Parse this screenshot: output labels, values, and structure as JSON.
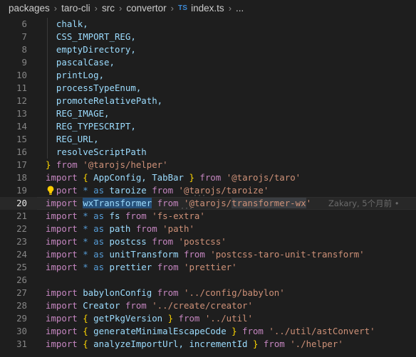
{
  "breadcrumb": {
    "items": [
      "packages",
      "taro-cli",
      "src",
      "convertor"
    ],
    "file_badge": "TS",
    "file_name": "index.ts",
    "trailing": "..."
  },
  "editor": {
    "current_line": 20,
    "blame": "Zakary, 5个月前 •",
    "lines": [
      {
        "n": "6",
        "tokens": [
          {
            "t": "  chalk,",
            "c": "id"
          }
        ]
      },
      {
        "n": "7",
        "tokens": [
          {
            "t": "  CSS_IMPORT_REG,",
            "c": "id"
          }
        ]
      },
      {
        "n": "8",
        "tokens": [
          {
            "t": "  emptyDirectory,",
            "c": "id"
          }
        ]
      },
      {
        "n": "9",
        "tokens": [
          {
            "t": "  pascalCase,",
            "c": "id"
          }
        ]
      },
      {
        "n": "10",
        "tokens": [
          {
            "t": "  printLog,",
            "c": "id"
          }
        ]
      },
      {
        "n": "11",
        "tokens": [
          {
            "t": "  processTypeEnum,",
            "c": "id"
          }
        ]
      },
      {
        "n": "12",
        "tokens": [
          {
            "t": "  promoteRelativePath,",
            "c": "id"
          }
        ]
      },
      {
        "n": "13",
        "tokens": [
          {
            "t": "  REG_IMAGE,",
            "c": "id"
          }
        ]
      },
      {
        "n": "14",
        "tokens": [
          {
            "t": "  REG_TYPESCRIPT,",
            "c": "id"
          }
        ]
      },
      {
        "n": "15",
        "tokens": [
          {
            "t": "  REG_URL,",
            "c": "id"
          }
        ]
      },
      {
        "n": "16",
        "tokens": [
          {
            "t": "  resolveScriptPath",
            "c": "id"
          }
        ]
      },
      {
        "n": "17",
        "tokens": [
          {
            "t": "}",
            "c": "b"
          },
          {
            "t": " from ",
            "c": "imp"
          },
          {
            "t": "'@tarojs/helper'",
            "c": "s"
          }
        ]
      },
      {
        "n": "18",
        "tokens": [
          {
            "t": "import",
            "c": "imp"
          },
          {
            "t": " ",
            "c": "p"
          },
          {
            "t": "{",
            "c": "b"
          },
          {
            "t": " AppConfig, TabBar ",
            "c": "id"
          },
          {
            "t": "}",
            "c": "b"
          },
          {
            "t": " from ",
            "c": "imp"
          },
          {
            "t": "'@tarojs/taro'",
            "c": "s"
          }
        ]
      },
      {
        "n": "19",
        "tokens": [
          {
            "t": "  port",
            "c": "imp"
          },
          {
            "t": " * ",
            "c": "k"
          },
          {
            "t": "as",
            "c": "k"
          },
          {
            "t": " taroize ",
            "c": "id"
          },
          {
            "t": "from",
            "c": "imp"
          },
          {
            "t": " ",
            "c": "p"
          },
          {
            "t": "'@tarojs/taroize'",
            "c": "s"
          }
        ],
        "bulb": true
      },
      {
        "n": "20",
        "tokens": [
          {
            "t": "import",
            "c": "imp"
          },
          {
            "t": " ",
            "c": "p"
          },
          {
            "t": "wxTransformer",
            "c": "id",
            "sel": "sel"
          },
          {
            "t": " from ",
            "c": "imp"
          },
          {
            "t": "'@tarojs/",
            "c": "s"
          },
          {
            "t": "transformer-wx",
            "c": "s",
            "sel": "sel2"
          },
          {
            "t": "'",
            "c": "s"
          }
        ],
        "current": true
      },
      {
        "n": "21",
        "tokens": [
          {
            "t": "import",
            "c": "imp"
          },
          {
            "t": " * ",
            "c": "k"
          },
          {
            "t": "as",
            "c": "k"
          },
          {
            "t": " fs ",
            "c": "id"
          },
          {
            "t": "from",
            "c": "imp"
          },
          {
            "t": " ",
            "c": "p"
          },
          {
            "t": "'fs-extra'",
            "c": "s"
          }
        ]
      },
      {
        "n": "22",
        "tokens": [
          {
            "t": "import",
            "c": "imp"
          },
          {
            "t": " * ",
            "c": "k"
          },
          {
            "t": "as",
            "c": "k"
          },
          {
            "t": " path ",
            "c": "id"
          },
          {
            "t": "from",
            "c": "imp"
          },
          {
            "t": " ",
            "c": "p"
          },
          {
            "t": "'path'",
            "c": "s"
          }
        ]
      },
      {
        "n": "23",
        "tokens": [
          {
            "t": "import",
            "c": "imp"
          },
          {
            "t": " * ",
            "c": "k"
          },
          {
            "t": "as",
            "c": "k"
          },
          {
            "t": " postcss ",
            "c": "id"
          },
          {
            "t": "from",
            "c": "imp"
          },
          {
            "t": " ",
            "c": "p"
          },
          {
            "t": "'postcss'",
            "c": "s"
          }
        ]
      },
      {
        "n": "24",
        "tokens": [
          {
            "t": "import",
            "c": "imp"
          },
          {
            "t": " * ",
            "c": "k"
          },
          {
            "t": "as",
            "c": "k"
          },
          {
            "t": " unitTransform ",
            "c": "id"
          },
          {
            "t": "from",
            "c": "imp"
          },
          {
            "t": " ",
            "c": "p"
          },
          {
            "t": "'postcss-taro-unit-transform'",
            "c": "s"
          }
        ]
      },
      {
        "n": "25",
        "tokens": [
          {
            "t": "import",
            "c": "imp"
          },
          {
            "t": " * ",
            "c": "k"
          },
          {
            "t": "as",
            "c": "k"
          },
          {
            "t": " prettier ",
            "c": "id"
          },
          {
            "t": "from",
            "c": "imp"
          },
          {
            "t": " ",
            "c": "p"
          },
          {
            "t": "'prettier'",
            "c": "s"
          }
        ]
      },
      {
        "n": "26",
        "tokens": []
      },
      {
        "n": "27",
        "tokens": [
          {
            "t": "import",
            "c": "imp"
          },
          {
            "t": " babylonConfig ",
            "c": "id"
          },
          {
            "t": "from",
            "c": "imp"
          },
          {
            "t": " ",
            "c": "p"
          },
          {
            "t": "'../config/babylon'",
            "c": "s"
          }
        ]
      },
      {
        "n": "28",
        "tokens": [
          {
            "t": "import",
            "c": "imp"
          },
          {
            "t": " Creator ",
            "c": "id"
          },
          {
            "t": "from",
            "c": "imp"
          },
          {
            "t": " ",
            "c": "p"
          },
          {
            "t": "'../create/creator'",
            "c": "s"
          }
        ]
      },
      {
        "n": "29",
        "tokens": [
          {
            "t": "import",
            "c": "imp"
          },
          {
            "t": " ",
            "c": "p"
          },
          {
            "t": "{",
            "c": "b"
          },
          {
            "t": " getPkgVersion ",
            "c": "id"
          },
          {
            "t": "}",
            "c": "b"
          },
          {
            "t": " from ",
            "c": "imp"
          },
          {
            "t": "'../util'",
            "c": "s"
          }
        ]
      },
      {
        "n": "30",
        "tokens": [
          {
            "t": "import",
            "c": "imp"
          },
          {
            "t": " ",
            "c": "p"
          },
          {
            "t": "{",
            "c": "b"
          },
          {
            "t": " generateMinimalEscapeCode ",
            "c": "id"
          },
          {
            "t": "}",
            "c": "b"
          },
          {
            "t": " from ",
            "c": "imp"
          },
          {
            "t": "'../util/astConvert'",
            "c": "s"
          }
        ]
      },
      {
        "n": "31",
        "tokens": [
          {
            "t": "import",
            "c": "imp"
          },
          {
            "t": " ",
            "c": "p"
          },
          {
            "t": "{",
            "c": "b"
          },
          {
            "t": " analyzeImportUrl, incrementId ",
            "c": "id"
          },
          {
            "t": "}",
            "c": "b"
          },
          {
            "t": " from ",
            "c": "imp"
          },
          {
            "t": "'./helper'",
            "c": "s"
          }
        ]
      }
    ]
  }
}
